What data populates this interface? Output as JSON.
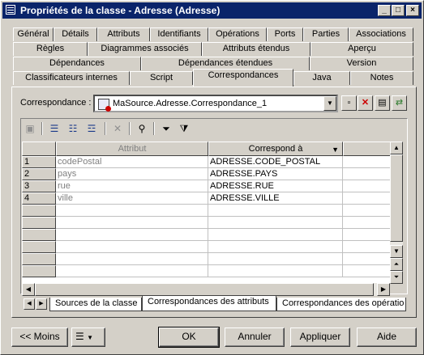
{
  "window": {
    "title": "Propriétés de la classe - Adresse (Adresse)",
    "controls": {
      "minimize": "_",
      "maximize": "□",
      "close": "×"
    }
  },
  "tabs": {
    "row1": [
      "Général",
      "Détails",
      "Attributs",
      "Identifiants",
      "Opérations",
      "Ports",
      "Parties",
      "Associations"
    ],
    "row2": [
      "Règles",
      "Diagrammes associés",
      "Attributs étendus",
      "Aperçu"
    ],
    "row3": [
      "Dépendances",
      "Dépendances étendues",
      "Version"
    ],
    "row4": [
      "Classificateurs internes",
      "Script",
      "Correspondances",
      "Java",
      "Notes"
    ],
    "active": "Correspondances"
  },
  "mapping": {
    "label": "Correspondance :",
    "selected": "MaSource.Adresse.Correspondance_1",
    "icon": "class-mapping-icon"
  },
  "side_buttons": [
    "new-icon",
    "delete-icon",
    "properties-icon",
    "mapping-editor-icon"
  ],
  "toolbar": [
    "properties-icon",
    "add-row-icon",
    "insert-row-icon",
    "add-mapping-icon",
    "delete-icon",
    "find-icon",
    "filter-icon",
    "sort-filter-icon"
  ],
  "grid": {
    "columns": [
      "Attribut",
      "Correspond à"
    ],
    "rows": [
      {
        "num": "1",
        "attribut": "codePostal",
        "correspond": "ADRESSE.CODE_POSTAL"
      },
      {
        "num": "2",
        "attribut": "pays",
        "correspond": "ADRESSE.PAYS"
      },
      {
        "num": "3",
        "attribut": "rue",
        "correspond": "ADRESSE.RUE"
      },
      {
        "num": "4",
        "attribut": "ville",
        "correspond": "ADRESSE.VILLE"
      }
    ]
  },
  "bottom_tabs": [
    "Sources de la classe",
    "Correspondances des attributs",
    "Correspondances des opératio"
  ],
  "active_bottom_tab": "Correspondances des attributs",
  "footer": {
    "less": "<< Moins",
    "ok": "OK",
    "cancel": "Annuler",
    "apply": "Appliquer",
    "help": "Aide"
  }
}
